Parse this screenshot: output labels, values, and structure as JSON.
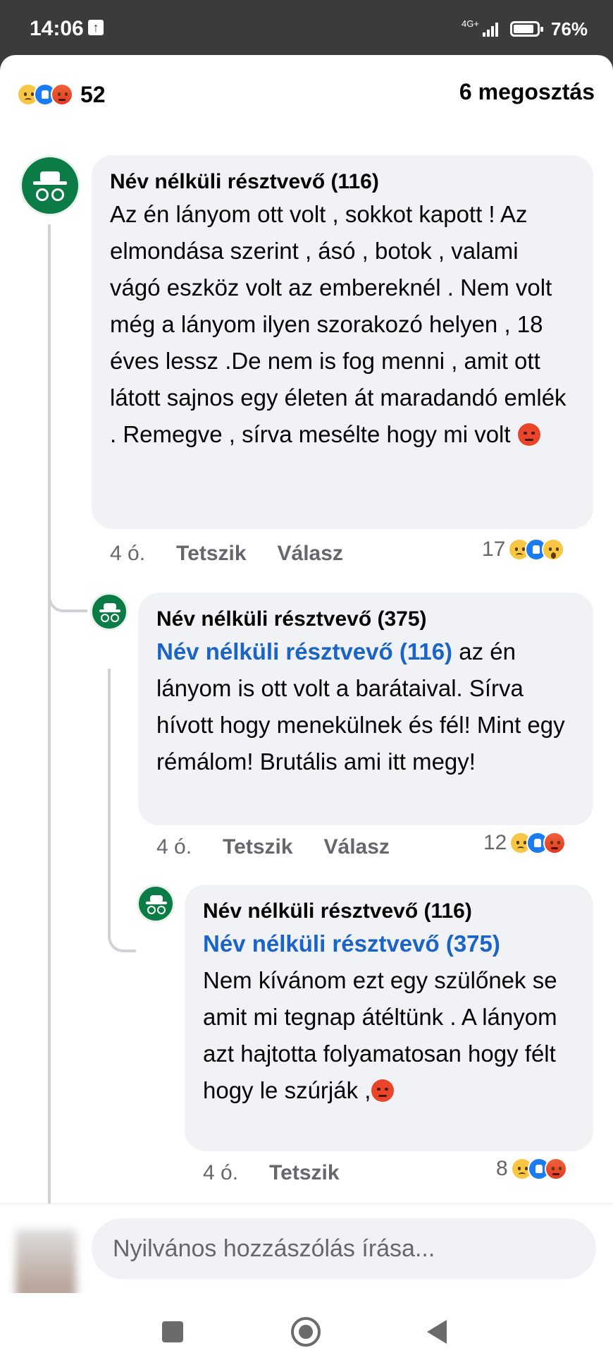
{
  "status_bar": {
    "time": "14:06",
    "network": "4G+",
    "battery": "76%"
  },
  "post_summary": {
    "reaction_count": "52",
    "reaction_icons": [
      "sad-emoji",
      "like",
      "angry-emoji"
    ],
    "shares": "6 megosztás"
  },
  "comments": [
    {
      "author": "Név nélküli résztvevő (116)",
      "text": "Az én lányom ott volt , sokkot kapott !   Az elmondása szerint , ásó , botok , valami vágó eszköz volt az embereknél . Nem volt még a lányom ilyen szorakozó helyen , 18 éves lessz .De nem is fog menni , amit ott látott sajnos egy életen át maradandó emlék .  Remegve , sírva mesélte hogy mi volt",
      "time": "4 ó.",
      "like_label": "Tetszik",
      "reply_label": "Válasz",
      "reaction_count": "17",
      "reaction_icons": [
        "sad-emoji",
        "like",
        "wow-emoji"
      ]
    },
    {
      "author": "Név nélküli résztvevő (375)",
      "mention": "Név nélküli résztvevő (116)",
      "text": " az én lányom is ott volt a barátaival. Sírva hívott hogy menekülnek és fél! Mint egy rémálom! Brutális ami itt megy!",
      "time": "4 ó.",
      "like_label": "Tetszik",
      "reply_label": "Válasz",
      "reaction_count": "12",
      "reaction_icons": [
        "sad-emoji",
        "like",
        "angry-emoji"
      ]
    },
    {
      "author": "Név nélküli résztvevő (116)",
      "mention": "Név nélküli résztvevő (375)",
      "text": "Nem kívánom ezt egy szülőnek se amit mi tegnap átéltünk . A lányom azt hajtotta folyamatosan hogy félt hogy le szúrják ,",
      "time": "4 ó.",
      "like_label": "Tetszik",
      "reaction_count": "8",
      "reaction_icons": [
        "sad-emoji",
        "like",
        "angry-emoji"
      ]
    }
  ],
  "composer": {
    "placeholder": "Nyilvános hozzászólás írása..."
  }
}
